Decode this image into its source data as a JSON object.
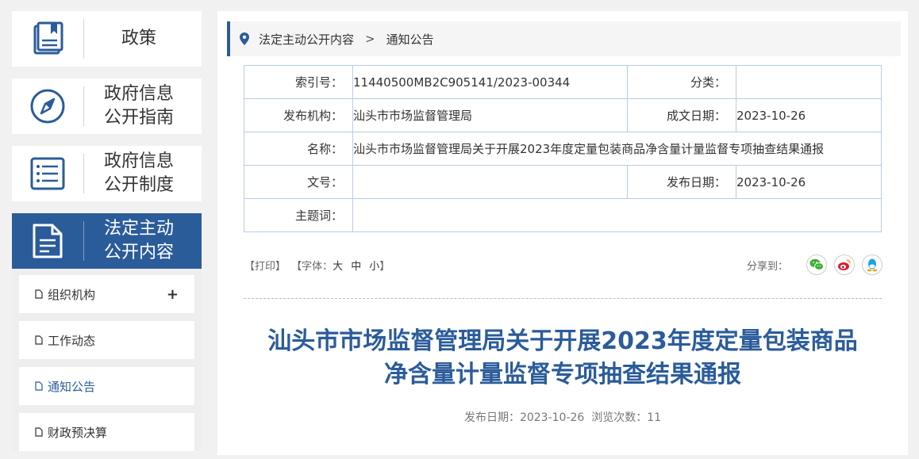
{
  "sidebar": {
    "cards": [
      {
        "label_l1": "政策",
        "label_l2": "",
        "icon": "book-icon"
      },
      {
        "label_l1": "政府信息",
        "label_l2": "公开指南",
        "icon": "compass-icon"
      },
      {
        "label_l1": "政府信息",
        "label_l2": "公开制度",
        "icon": "list-icon"
      },
      {
        "label_l1": "法定主动",
        "label_l2": "公开内容",
        "icon": "document-icon"
      }
    ],
    "subitems": [
      {
        "label": "组织机构",
        "expand": "+"
      },
      {
        "label": "工作动态"
      },
      {
        "label": "通知公告"
      },
      {
        "label": "财政预决算"
      }
    ]
  },
  "breadcrumb": {
    "items": [
      "法定主动公开内容",
      "通知公告"
    ],
    "separator": ">"
  },
  "meta": {
    "index_label": "索引号：",
    "index_value": "11440500MB2C905141/2023-00344",
    "category_label": "分类：",
    "category_value": "",
    "publisher_label": "发布机构：",
    "publisher_value": "汕头市市场监督管理局",
    "written_date_label": "成文日期：",
    "written_date_value": "2023-10-26",
    "name_label": "名称：",
    "name_value": "汕头市市场监督管理局关于开展2023年度定量包装商品净含量计量监督专项抽查结果通报",
    "doc_no_label": "文号：",
    "doc_no_value": "",
    "publish_date_label": "发布日期：",
    "publish_date_value": "2023-10-26",
    "keywords_label": "主题词：",
    "keywords_value": ""
  },
  "tools": {
    "print": "【打印】",
    "font_prefix": "【字体：",
    "font_large": "大",
    "font_medium": "中",
    "font_small": "小",
    "font_suffix": "】",
    "share_label": "分享到：",
    "share_icons": [
      "wechat-icon",
      "weibo-icon",
      "qq-icon"
    ]
  },
  "article": {
    "title_l1": "汕头市市场监督管理局关于开展2023年度定量包装商品",
    "title_l2": "净含量计量监督专项抽查结果通报",
    "publish_info": "发布日期：2023-10-26  浏览次数：11"
  },
  "colors": {
    "accent": "#2b5c9a",
    "wechat": "#3cb034",
    "weibo": "#e6162d",
    "qq": "#1aa3e8"
  }
}
